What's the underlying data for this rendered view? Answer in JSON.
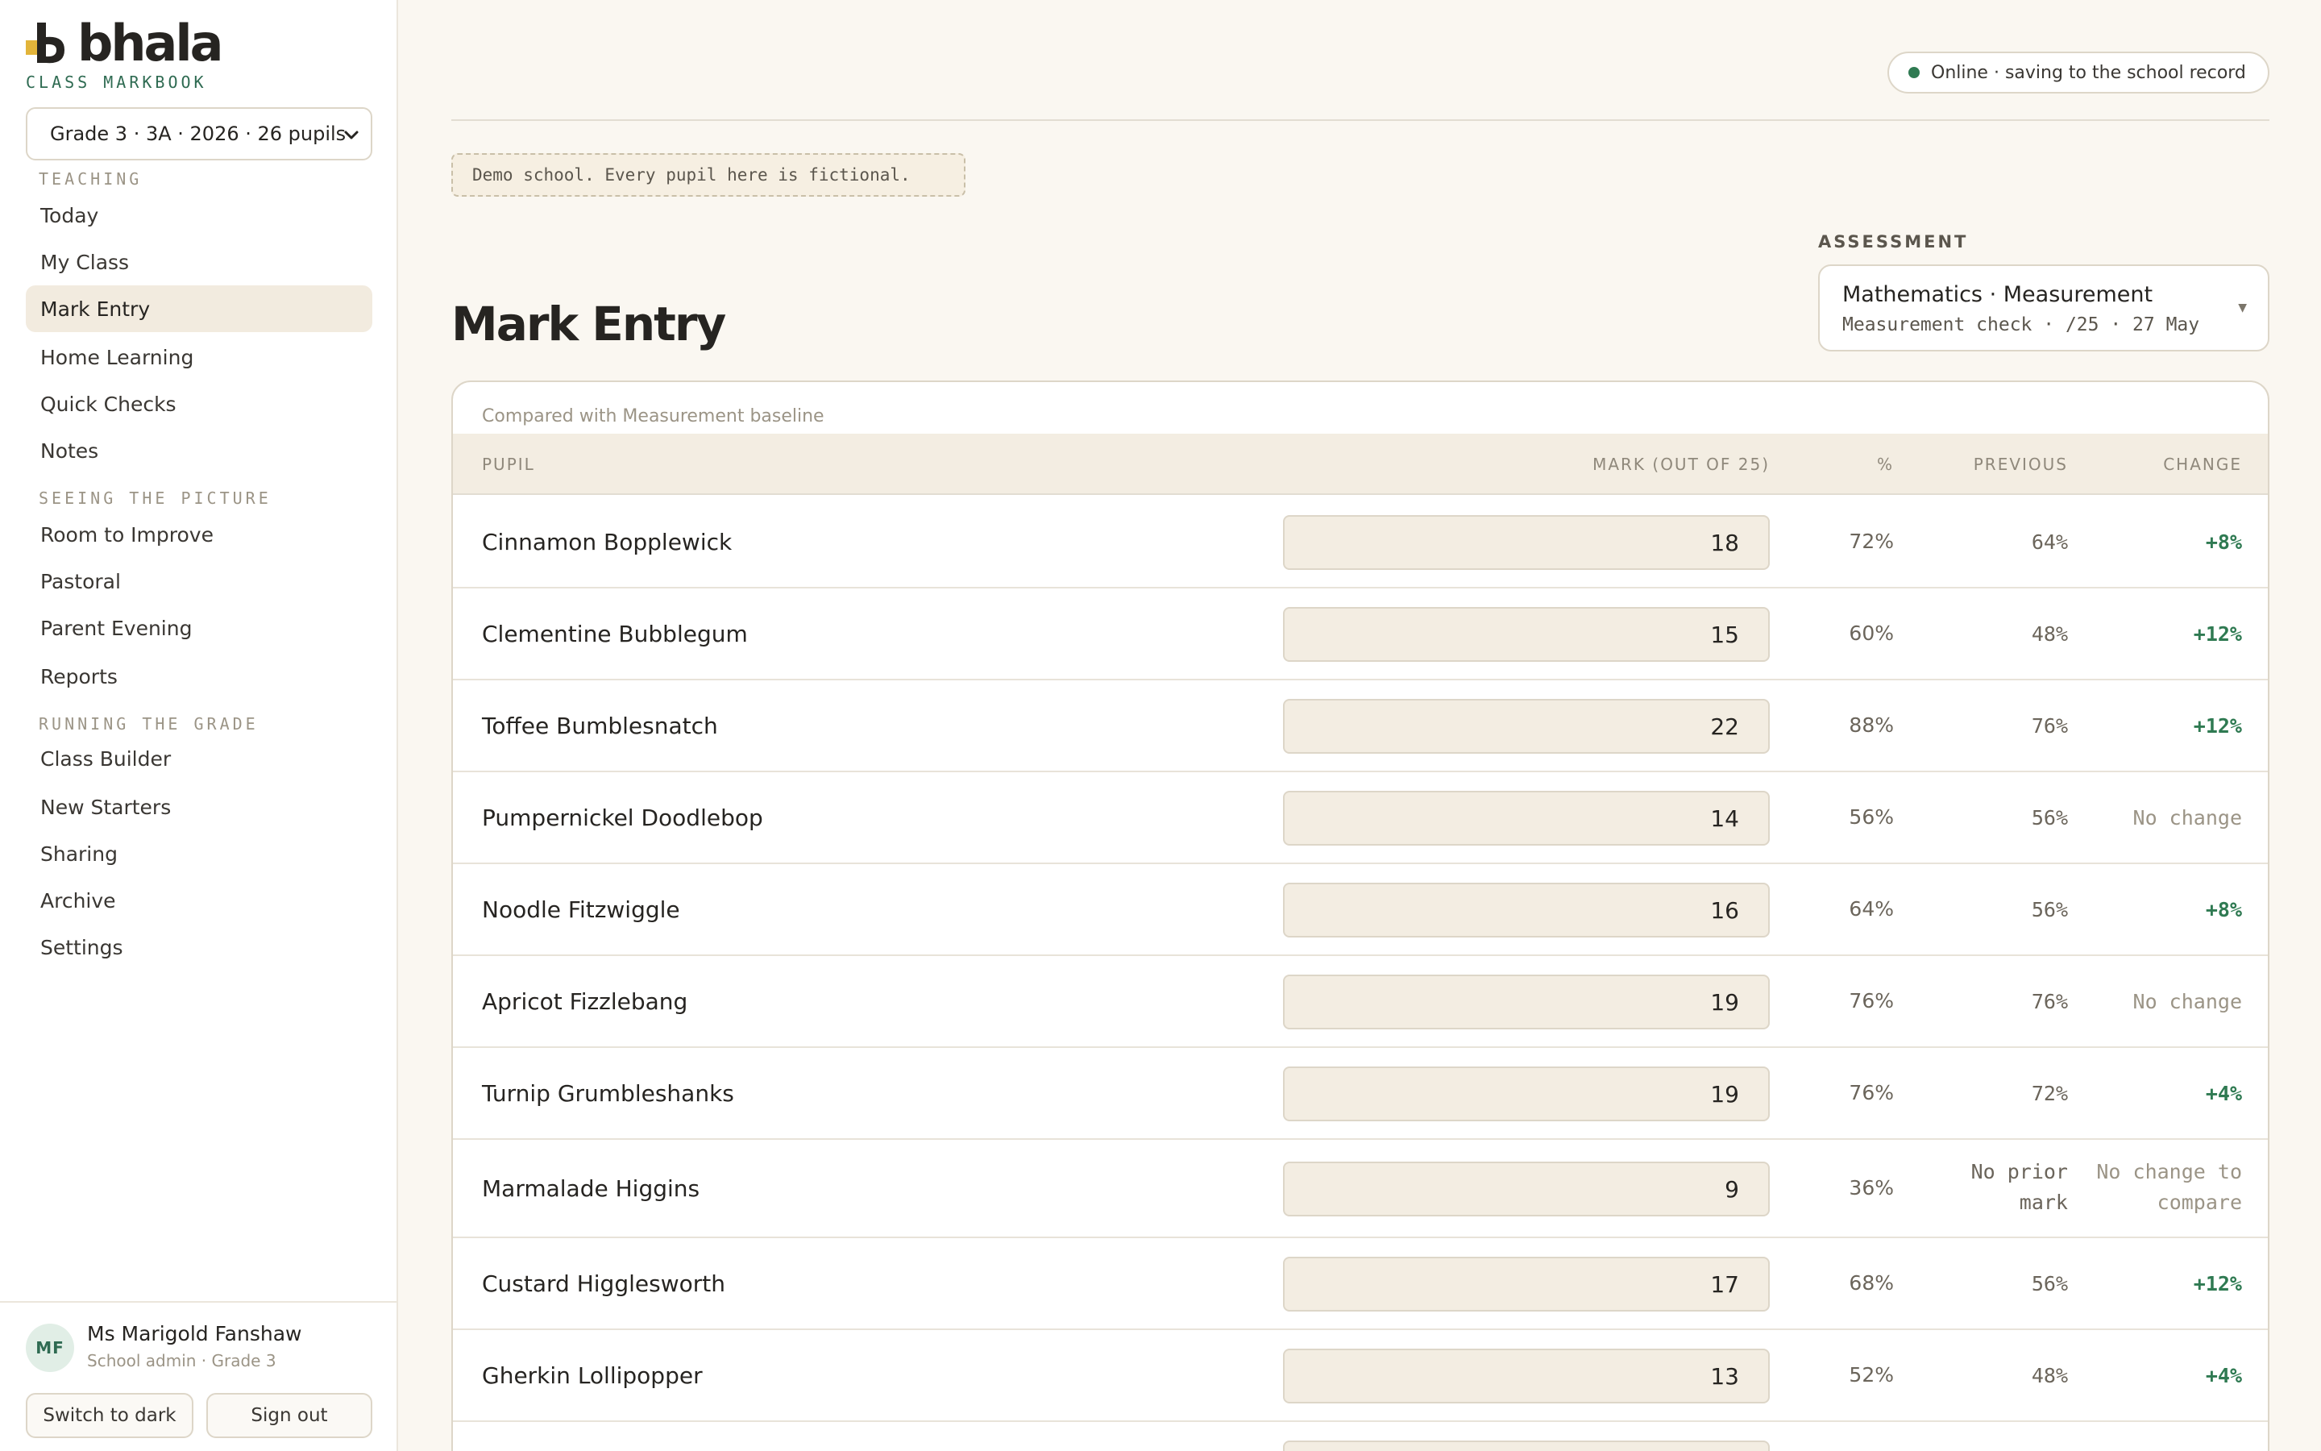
{
  "brand": {
    "name": "bhala",
    "subtitle": "CLASS MARKBOOK"
  },
  "class_selector": {
    "value": "Grade 3 · 3A · 2026 · 26 pupils"
  },
  "nav": {
    "sections": [
      {
        "title": "TEACHING",
        "items": [
          "Today",
          "My Class",
          "Mark Entry",
          "Home Learning",
          "Quick Checks",
          "Notes"
        ]
      },
      {
        "title": "SEEING THE PICTURE",
        "items": [
          "Room to Improve",
          "Pastoral",
          "Parent Evening",
          "Reports"
        ]
      },
      {
        "title": "RUNNING THE GRADE",
        "items": [
          "Class Builder",
          "New Starters",
          "Sharing",
          "Archive",
          "Settings"
        ]
      }
    ],
    "active": "Mark Entry"
  },
  "user": {
    "initials": "MF",
    "name": "Ms Marigold Fanshaw",
    "role": "School admin · Grade 3",
    "theme_button": "Switch to dark",
    "signout_button": "Sign out"
  },
  "status": {
    "text": "Online · saving to the school record",
    "color": "#2f7a52"
  },
  "demo_note": "Demo school. Every pupil here is fictional.",
  "page_title": "Mark Entry",
  "assessment": {
    "label": "ASSESSMENT",
    "title": "Mathematics · Measurement",
    "subtitle": "Measurement check · /25 · 27 May"
  },
  "table": {
    "caption": "Compared with Measurement baseline",
    "headers": {
      "pupil": "PUPIL",
      "mark": "MARK (OUT OF 25)",
      "pct": "%",
      "previous": "PREVIOUS",
      "change": "CHANGE"
    },
    "rows": [
      {
        "name": "Cinnamon Bopplewick",
        "mark": "18",
        "pct": "72%",
        "previous": "64%",
        "change": "+8%",
        "trend": "up"
      },
      {
        "name": "Clementine Bubblegum",
        "mark": "15",
        "pct": "60%",
        "previous": "48%",
        "change": "+12%",
        "trend": "up"
      },
      {
        "name": "Toffee Bumblesnatch",
        "mark": "22",
        "pct": "88%",
        "previous": "76%",
        "change": "+12%",
        "trend": "up"
      },
      {
        "name": "Pumpernickel Doodlebop",
        "mark": "14",
        "pct": "56%",
        "previous": "56%",
        "change": "No change",
        "trend": "none"
      },
      {
        "name": "Noodle Fitzwiggle",
        "mark": "16",
        "pct": "64%",
        "previous": "56%",
        "change": "+8%",
        "trend": "up"
      },
      {
        "name": "Apricot Fizzlebang",
        "mark": "19",
        "pct": "76%",
        "previous": "76%",
        "change": "No change",
        "trend": "none"
      },
      {
        "name": "Turnip Grumbleshanks",
        "mark": "19",
        "pct": "76%",
        "previous": "72%",
        "change": "+4%",
        "trend": "up"
      },
      {
        "name": "Marmalade Higgins",
        "mark": "9",
        "pct": "36%",
        "previous": "No prior mark",
        "change": "No change to compare",
        "trend": "none"
      },
      {
        "name": "Custard Higglesworth",
        "mark": "17",
        "pct": "68%",
        "previous": "56%",
        "change": "+12%",
        "trend": "up"
      },
      {
        "name": "Gherkin Lollipopper",
        "mark": "13",
        "pct": "52%",
        "previous": "48%",
        "change": "+4%",
        "trend": "up"
      }
    ]
  }
}
